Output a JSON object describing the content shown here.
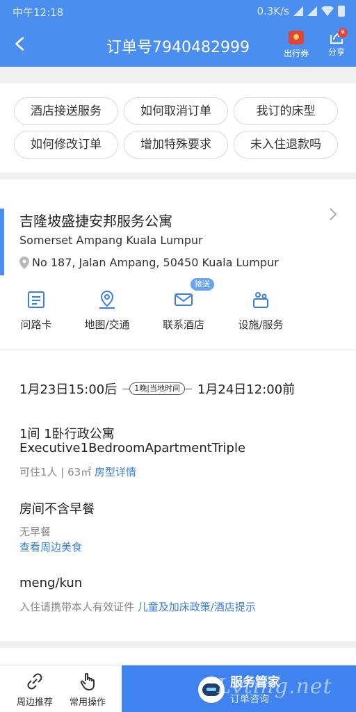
{
  "status_bar": {
    "time": "中午12:18",
    "speed": "0.3K/s"
  },
  "header": {
    "title": "订单号7940482999",
    "coupon_label": "出行券",
    "share_label": "分享",
    "share_badge": "¥"
  },
  "chips": [
    "酒店接送服务",
    "如何取消订单",
    "我订的床型",
    "如何修改订单",
    "增加特殊要求",
    "未入住退款吗"
  ],
  "hotel": {
    "name": "吉隆坡盛捷安邦服务公寓",
    "name_en": "Somerset Ampang Kuala Lumpur",
    "address": "No 187, Jalan Ampang, 50450 Kuala Lumpur",
    "tools": [
      {
        "label": "问路卡",
        "icon": "card-icon"
      },
      {
        "label": "地图/交通",
        "icon": "map-pin-icon"
      },
      {
        "label": "联系酒店",
        "icon": "mail-icon"
      },
      {
        "label": "设施/服务",
        "icon": "facilities-icon"
      }
    ],
    "contact_badge": "接送"
  },
  "stay": {
    "checkin": "1月23日15:00后",
    "nights": "1晚|当地时间",
    "checkout": "1月24日12:00前"
  },
  "room": {
    "title": "1间 1卧行政公寓",
    "name_en": "Executive1BedroomApartmentTriple",
    "meta": "可住1人 | 63㎡",
    "detail_link": "房型详情"
  },
  "breakfast": {
    "title": "房间不含早餐",
    "sub": "无早餐",
    "link": "查看周边美食"
  },
  "guest": {
    "name": "meng/kun",
    "note": "入住请携带本人有效证件",
    "policy_link": "儿童及加床政策/酒店提示"
  },
  "bottom_bar": {
    "nearby": "周边推荐",
    "common": "常用操作",
    "assistant_title": "服务管家",
    "assistant_sub": "订单咨询",
    "watermark": "Lvting.net"
  },
  "colors": {
    "brand": "#4a8ef0",
    "link": "#3a7fe0",
    "assistant": "#3f83f0"
  }
}
